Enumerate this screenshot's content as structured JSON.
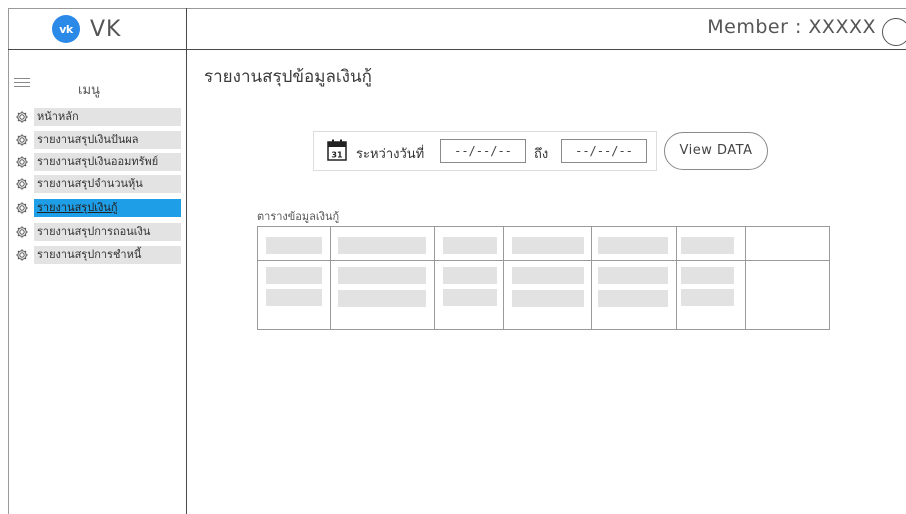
{
  "app": {
    "logo_mark": "vk",
    "logo_text": "VK"
  },
  "header": {
    "member_label": "Member : XXXXX"
  },
  "sidebar": {
    "menu_label": "เมนู",
    "items": [
      {
        "label": "หน้าหลัก",
        "icon": "gear-icon",
        "active": false
      },
      {
        "label": "รายงานสรุปเงินปันผล",
        "icon": "gear-icon",
        "active": false
      },
      {
        "label": "รายงานสรุปเงินออมทรัพย์",
        "icon": "gear-icon",
        "active": false
      },
      {
        "label": "รายงานสรุปจำนวนหุ้น",
        "icon": "gear-icon",
        "active": false
      },
      {
        "label": "รายงานสรุปเงินกู้",
        "icon": "gear-icon",
        "active": true
      },
      {
        "label": "รายงานสรุปการถอนเงิน",
        "icon": "gear-icon",
        "active": false
      },
      {
        "label": "รายงานสรุปการชำหนี้",
        "icon": "gear-icon",
        "active": false
      }
    ]
  },
  "main": {
    "title": "รายงานสรุปข้อมูลเงินกู้",
    "filter": {
      "calendar_day": "31",
      "between_label": "ระหว่างวันที่",
      "from_value": "--/--/--",
      "to_label": "ถึง",
      "to_value": "--/--/--",
      "view_button": "View DATA"
    },
    "table_caption": "ตารางข้อมูลเงินกู้"
  },
  "colors": {
    "accent": "#1f9ee8",
    "vk_brand": "#2b89e8",
    "placeholder": "#e2e2e2",
    "sidebar_item_bg": "#e3e3e3"
  }
}
